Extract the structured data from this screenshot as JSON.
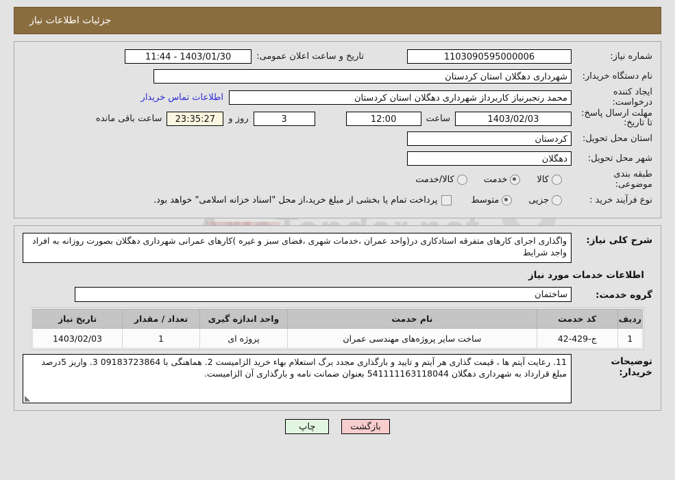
{
  "header": {
    "title": "جزئیات اطلاعات نیاز"
  },
  "form": {
    "need_number_label": "شماره نیاز:",
    "need_number_value": "1103090595000006",
    "announce_datetime_label": "تاریخ و ساعت اعلان عمومی:",
    "announce_datetime_value": "1403/01/30 - 11:44",
    "buyer_org_label": "نام دستگاه خریدار:",
    "buyer_org_value": "شهرداری دهگلان استان کردستان",
    "creator_label": "ایجاد کننده درخواست:",
    "creator_value": "محمد رنجبرنیاز کاربرداز شهرداری دهگلان استان کردستان",
    "contact_link": "اطلاعات تماس خریدار",
    "deadline_label": "مهلت ارسال پاسخ: تا تاریخ:",
    "deadline_date": "1403/02/03",
    "hour_label": "ساعت",
    "deadline_time": "12:00",
    "days_remaining": "3",
    "days_unit_label": "روز و",
    "countdown": "23:35:27",
    "countdown_suffix_label": "ساعت باقی مانده",
    "province_label": "استان محل تحویل:",
    "province_value": "کردستان",
    "city_label": "شهر محل تحویل:",
    "city_value": "دهگلان",
    "category_label": "طبقه بندی موضوعی:",
    "category_options": [
      {
        "label": "کالا",
        "selected": false
      },
      {
        "label": "خدمت",
        "selected": true
      },
      {
        "label": "کالا/خدمت",
        "selected": false
      }
    ],
    "process_label": "نوع فرآیند خرید :",
    "process_options": [
      {
        "label": "جزیی",
        "selected": false
      },
      {
        "label": "متوسط",
        "selected": true
      }
    ],
    "treasury_checkbox_label": "پرداخت تمام یا بخشی از مبلغ خرید،از محل \"اسناد خزانه اسلامی\" خواهد بود.",
    "treasury_checked": false
  },
  "description": {
    "label": "شرح کلی نیاز:",
    "value": "واگذاری اجرای کارهای متفرقه استادکاری در(واحد عمران ،خدمات شهری ،فضای سبز و غیره )کارهای عمرانی شهرداری دهگلان بصورت روزانه به افراد واجد شرایط"
  },
  "services": {
    "section_title": "اطلاعات خدمات مورد نیاز",
    "group_label": "گروه خدمت:",
    "group_value": "ساختمان",
    "columns": [
      "ردیف",
      "کد خدمت",
      "نام خدمت",
      "واحد اندازه گیری",
      "تعداد / مقدار",
      "تاریخ نیاز"
    ],
    "rows": [
      {
        "index": "1",
        "code": "ج-429-42",
        "name": "ساخت سایر پروژه‌های مهندسی عمران",
        "unit": "پروژه ای",
        "quantity": "1",
        "need_date": "1403/02/03"
      }
    ]
  },
  "buyer_notes": {
    "label": "توضیحات خریدار:",
    "value": "11. رعایت آیتم ها ، قیمت گذاری هر آیتم و تایید و بارگذاری مجدد برگ استعلام بهاء خرید الزامیست 2. هماهنگی با 09183723864   3. واریز 5درصد مبلغ قرارداد به شهرداری دهگلان 541111163118044  بعنوان ضمانت نامه و بارگذاری آن الزامیست."
  },
  "footer": {
    "back_label": "بازگشت",
    "print_label": "چاپ"
  },
  "watermark": {
    "text": "AriaTender.net"
  }
}
